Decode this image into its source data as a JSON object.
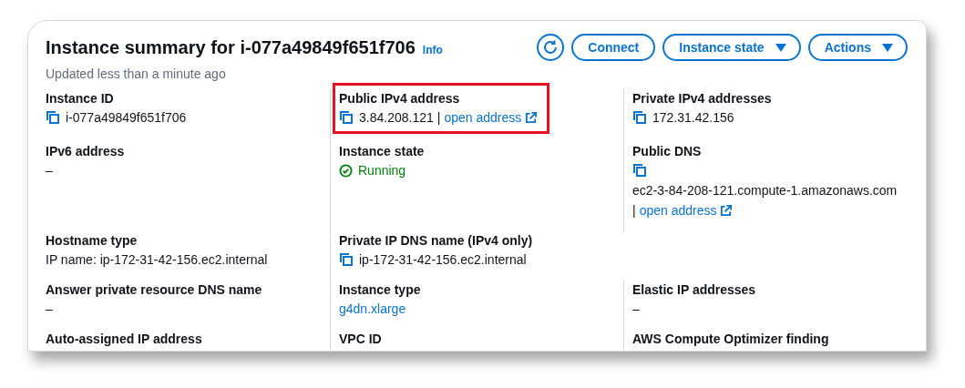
{
  "header": {
    "title": "Instance summary for i-077a49849f651f706",
    "info": "Info",
    "updated": "Updated less than a minute ago",
    "buttons": [
      {
        "kind": "refresh"
      },
      {
        "kind": "button",
        "label": "Connect"
      },
      {
        "kind": "dropdown",
        "label": "Instance state"
      },
      {
        "kind": "dropdown",
        "label": "Actions"
      }
    ]
  },
  "rows": [
    [
      {
        "label": "Instance ID",
        "value": {
          "kind": "copy",
          "text": "i-077a49849f651f706"
        }
      },
      {
        "label": "Public IPv4 address",
        "highlighted": true,
        "value": {
          "kind": "copy-link",
          "text": "3.84.208.121",
          "separator": "|",
          "link": "open address"
        }
      },
      {
        "label": "Private IPv4 addresses",
        "value": {
          "kind": "copy",
          "text": "172.31.42.156"
        }
      }
    ],
    [
      {
        "label": "IPv6 address",
        "value": {
          "kind": "text",
          "text": "–"
        }
      },
      {
        "label": "Instance state",
        "value": {
          "kind": "status",
          "text": "Running"
        }
      },
      {
        "label": "Public DNS",
        "value": {
          "kind": "copy-block",
          "text": "ec2-3-84-208-121.compute-1.amazonaws.com",
          "separator": "|",
          "link": "open address"
        }
      }
    ],
    [
      {
        "label": "Hostname type",
        "value": {
          "kind": "text",
          "text": "IP name: ip-172-31-42-156.ec2.internal"
        }
      },
      {
        "label": "Private IP DNS name (IPv4 only)",
        "value": {
          "kind": "copy",
          "text": "ip-172-31-42-156.ec2.internal"
        }
      }
    ],
    [
      {
        "label": "Answer private resource DNS name",
        "value": {
          "kind": "text",
          "text": "–"
        }
      },
      {
        "label": "Instance type",
        "value": {
          "kind": "link",
          "text": "g4dn.xlarge"
        }
      },
      {
        "label": "Elastic IP addresses",
        "value": {
          "kind": "text",
          "text": "–"
        }
      }
    ],
    [
      {
        "label": "Auto-assigned IP address"
      },
      {
        "label": "VPC ID"
      },
      {
        "label": "AWS Compute Optimizer finding"
      }
    ]
  ]
}
